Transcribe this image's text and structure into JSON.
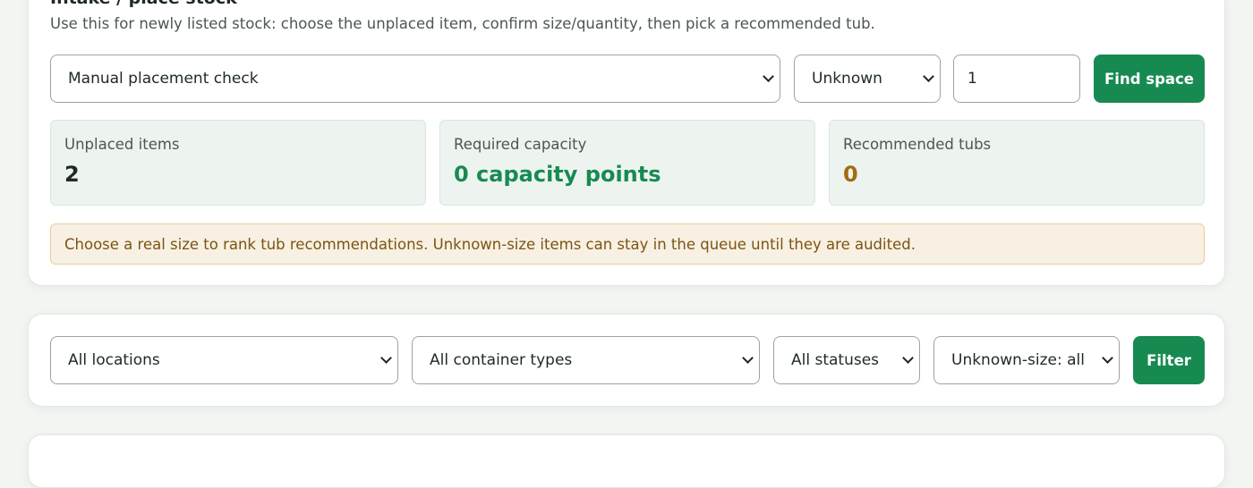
{
  "intake": {
    "title": "Intake / place stock",
    "subtitle": "Use this for newly listed stock: choose the unplaced item, confirm size/quantity, then pick a recommended tub.",
    "item_select": "Manual placement check",
    "size_select": "Unknown",
    "quantity_value": "1",
    "find_space_label": "Find space",
    "stats": [
      {
        "label": "Unplaced items",
        "value": "2",
        "color": "#1f2a24"
      },
      {
        "label": "Required capacity",
        "value": "0 capacity points",
        "color": "#178a52"
      },
      {
        "label": "Recommended tubs",
        "value": "0",
        "color": "#a36c12"
      }
    ],
    "notice": "Choose a real size to rank tub recommendations. Unknown-size items can stay in the queue until they are audited."
  },
  "filters": {
    "location_select": "All locations",
    "container_type_select": "All container types",
    "status_select": "All statuses",
    "unknown_size_select": "Unknown-size: all",
    "filter_label": "Filter"
  },
  "colors": {
    "accent": "#178a52",
    "notice_bg": "#f8f0e2",
    "notice_text": "#7a5513"
  }
}
